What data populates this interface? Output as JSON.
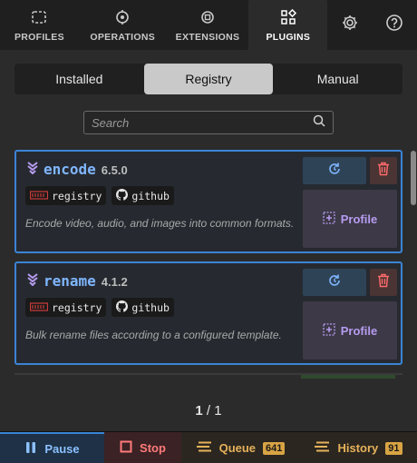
{
  "top_tabs": [
    {
      "label": "PROFILES",
      "icon": "profiles-icon"
    },
    {
      "label": "OPERATIONS",
      "icon": "operations-icon"
    },
    {
      "label": "EXTENSIONS",
      "icon": "extensions-icon"
    },
    {
      "label": "PLUGINS",
      "icon": "plugins-icon"
    }
  ],
  "segments": {
    "installed": "Installed",
    "registry": "Registry",
    "manual": "Manual"
  },
  "search": {
    "placeholder": "Search"
  },
  "plugins": [
    {
      "name": "encode",
      "version": "6.5.0",
      "tags": [
        "registry",
        "github"
      ],
      "description": "Encode video, audio, and images into common formats.",
      "profile_label": "Profile"
    },
    {
      "name": "rename",
      "version": "4.1.2",
      "tags": [
        "registry",
        "github"
      ],
      "description": "Bulk rename files according to a configured template.",
      "profile_label": "Profile"
    }
  ],
  "pager": {
    "current": "1",
    "separator": "/",
    "total": "1"
  },
  "bottom": {
    "pause": "Pause",
    "stop": "Stop",
    "queue": "Queue",
    "queue_count": "641",
    "history": "History",
    "history_count": "91"
  },
  "colors": {
    "accent": "#3b84d6",
    "profile": "#b79cf0",
    "queue": "#e6b25a",
    "stop": "#ff7b7b"
  }
}
